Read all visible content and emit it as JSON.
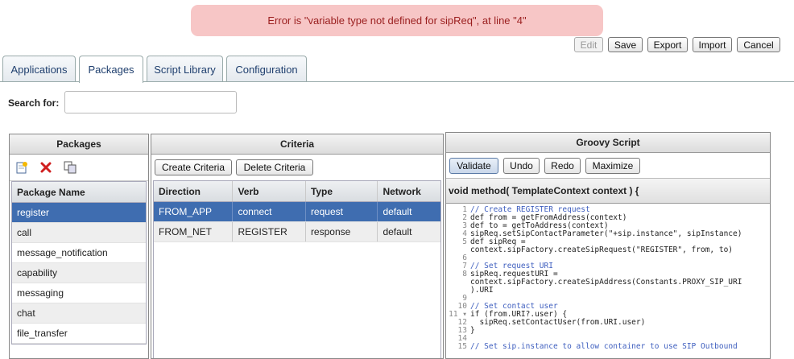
{
  "error": {
    "message": "Error is \"variable type not defined for sipReq\", at line \"4\""
  },
  "toolbar": {
    "edit": "Edit",
    "save": "Save",
    "export": "Export",
    "import": "Import",
    "cancel": "Cancel"
  },
  "tabs": [
    "Applications",
    "Packages",
    "Script Library",
    "Configuration"
  ],
  "search": {
    "label": "Search for:",
    "value": ""
  },
  "packages": {
    "title": "Packages",
    "column": "Package Name",
    "items": [
      "register",
      "call",
      "message_notification",
      "capability",
      "messaging",
      "chat",
      "file_transfer"
    ]
  },
  "criteria": {
    "title": "Criteria",
    "create": "Create Criteria",
    "delete": "Delete Criteria",
    "columns": [
      "Direction",
      "Verb",
      "Type",
      "Network"
    ],
    "rows": [
      [
        "FROM_APP",
        "connect",
        "request",
        "default"
      ],
      [
        "FROM_NET",
        "REGISTER",
        "response",
        "default"
      ]
    ]
  },
  "script": {
    "title": "Groovy Script",
    "validate": "Validate",
    "undo": "Undo",
    "redo": "Redo",
    "maximize": "Maximize",
    "signature": "void method( TemplateContext context ) {",
    "lines": [
      {
        "n": "1",
        "t": "// Create REGISTER request"
      },
      {
        "n": "2",
        "t": "def from = getFromAddress(context)"
      },
      {
        "n": "3",
        "t": "def to = getToAddress(context)"
      },
      {
        "n": "4",
        "t": "sipReq.setSipContactParameter(\"+sip.instance\", sipInstance)"
      },
      {
        "n": "5",
        "t": "def sipReq ="
      },
      {
        "n": "",
        "t": "context.sipFactory.createSipRequest(\"REGISTER\", from, to)"
      },
      {
        "n": "6",
        "t": ""
      },
      {
        "n": "7",
        "t": "// Set request URI"
      },
      {
        "n": "8",
        "t": "sipReq.requestURI ="
      },
      {
        "n": "",
        "t": "context.sipFactory.createSipAddress(Constants.PROXY_SIP_URI"
      },
      {
        "n": "",
        "t": ").URI"
      },
      {
        "n": "9",
        "t": ""
      },
      {
        "n": "10",
        "t": "// Set contact user"
      },
      {
        "n": "11 ▾",
        "t": "if (from.URI?.user) {"
      },
      {
        "n": "12",
        "t": "  sipReq.setContactUser(from.URI.user)"
      },
      {
        "n": "13",
        "t": "}"
      },
      {
        "n": "14",
        "t": ""
      },
      {
        "n": "15",
        "t": "// Set sip.instance to allow container to use SIP Outbound"
      }
    ]
  }
}
